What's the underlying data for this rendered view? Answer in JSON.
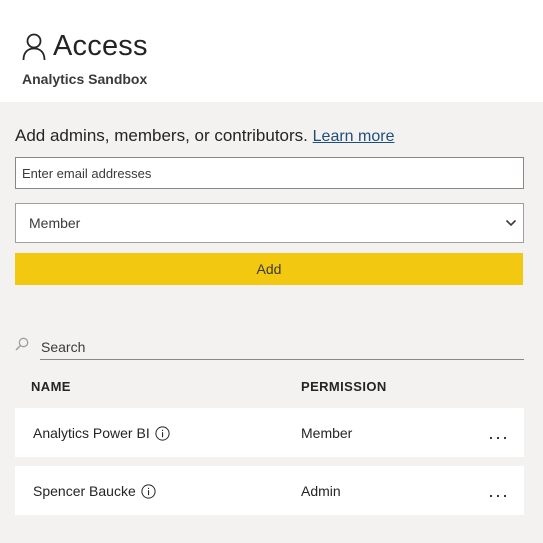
{
  "header": {
    "title": "Access",
    "subtitle": "Analytics Sandbox",
    "icon": "person-icon"
  },
  "form": {
    "prompt": "Add admins, members, or contributors.",
    "learn_more": "Learn more",
    "email_placeholder": "Enter email addresses",
    "role_selected": "Member",
    "add_label": "Add",
    "accent_color": "#f2c811"
  },
  "list": {
    "search_placeholder": "Search",
    "columns": {
      "name": "NAME",
      "permission": "PERMISSION"
    },
    "rows": [
      {
        "name": "Analytics Power BI",
        "permission": "Member"
      },
      {
        "name": "Spencer Baucke",
        "permission": "Admin"
      }
    ],
    "more_label": "..."
  }
}
